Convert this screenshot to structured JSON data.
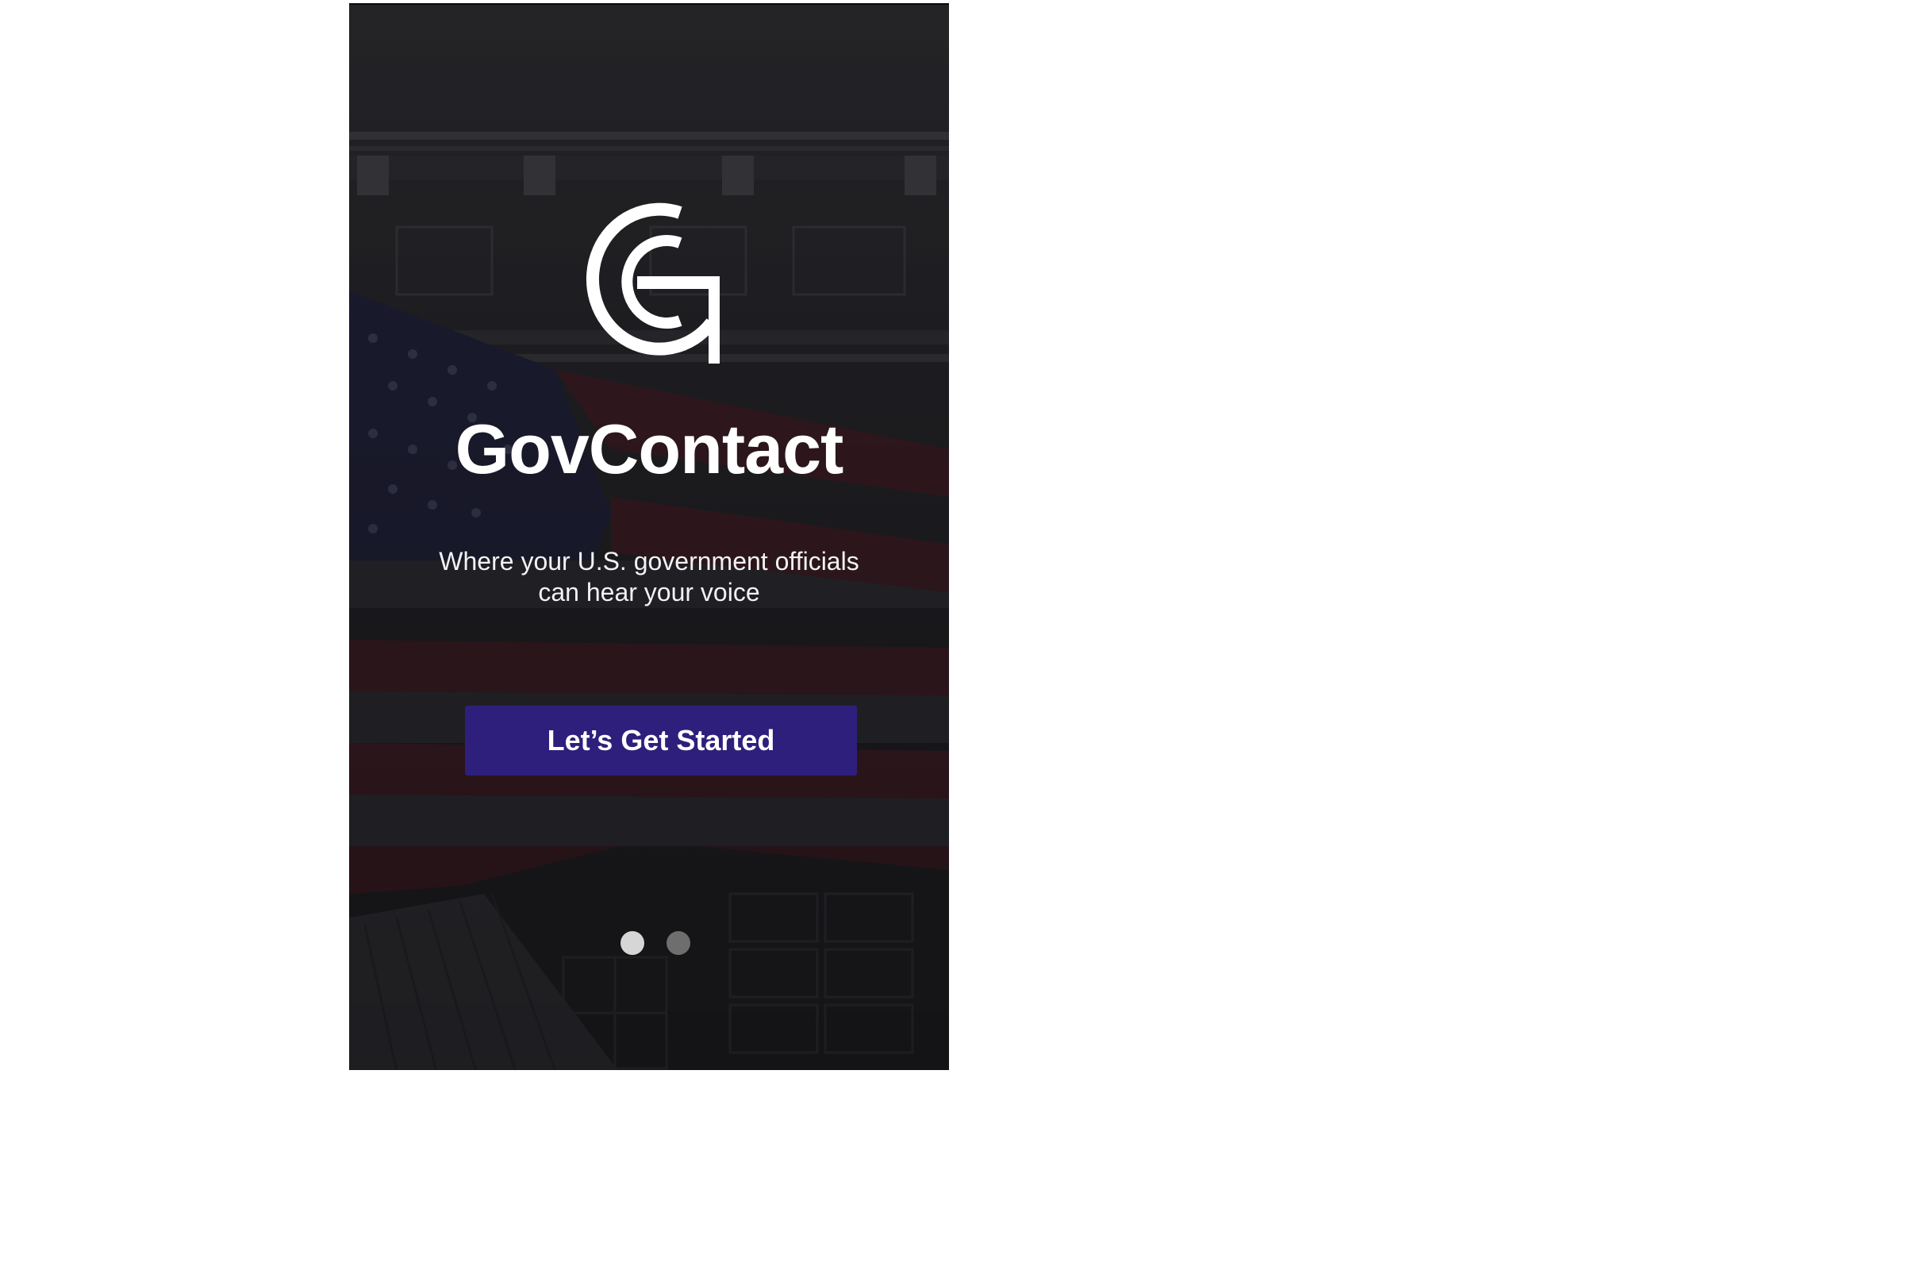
{
  "app": {
    "title": "GovContact",
    "tagline_line1": "Where your U.S. government officials",
    "tagline_line2": "can hear your voice",
    "logo_icon": "gc-monogram-icon"
  },
  "cta": {
    "label": "Let’s Get Started"
  },
  "pager": {
    "total_pages": 2,
    "active_page": 1
  },
  "colors": {
    "cta_background": "#2e1f7c",
    "text": "#ffffff",
    "background_overlay": "#1c1c22",
    "dot_active": "#d6d6d6",
    "dot_inactive": "#6e6e6e"
  }
}
